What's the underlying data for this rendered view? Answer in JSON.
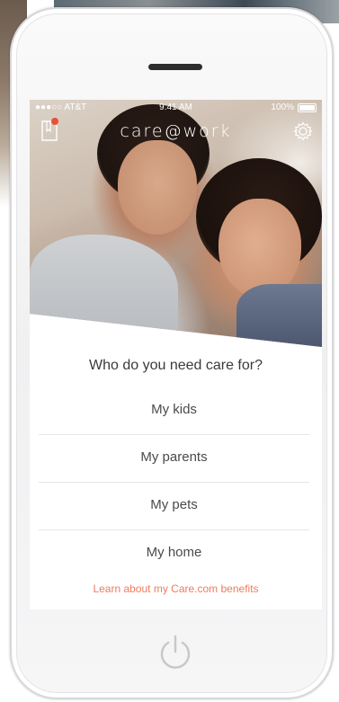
{
  "status_bar": {
    "carrier": "●●●○○ AT&T",
    "time": "9:41 AM",
    "battery": "100%"
  },
  "nav": {
    "brand": "care@work",
    "left_icon": "document-notification-icon",
    "right_icon": "gear-icon"
  },
  "prompt": {
    "question": "Who do you need care for?"
  },
  "options": [
    {
      "label": "My kids"
    },
    {
      "label": "My parents"
    },
    {
      "label": "My pets"
    },
    {
      "label": "My home"
    }
  ],
  "footer": {
    "benefits_link": "Learn about my Care.com benefits"
  },
  "colors": {
    "accent": "#f07b5c",
    "badge": "#e8503a",
    "text": "#4a4a4a"
  }
}
